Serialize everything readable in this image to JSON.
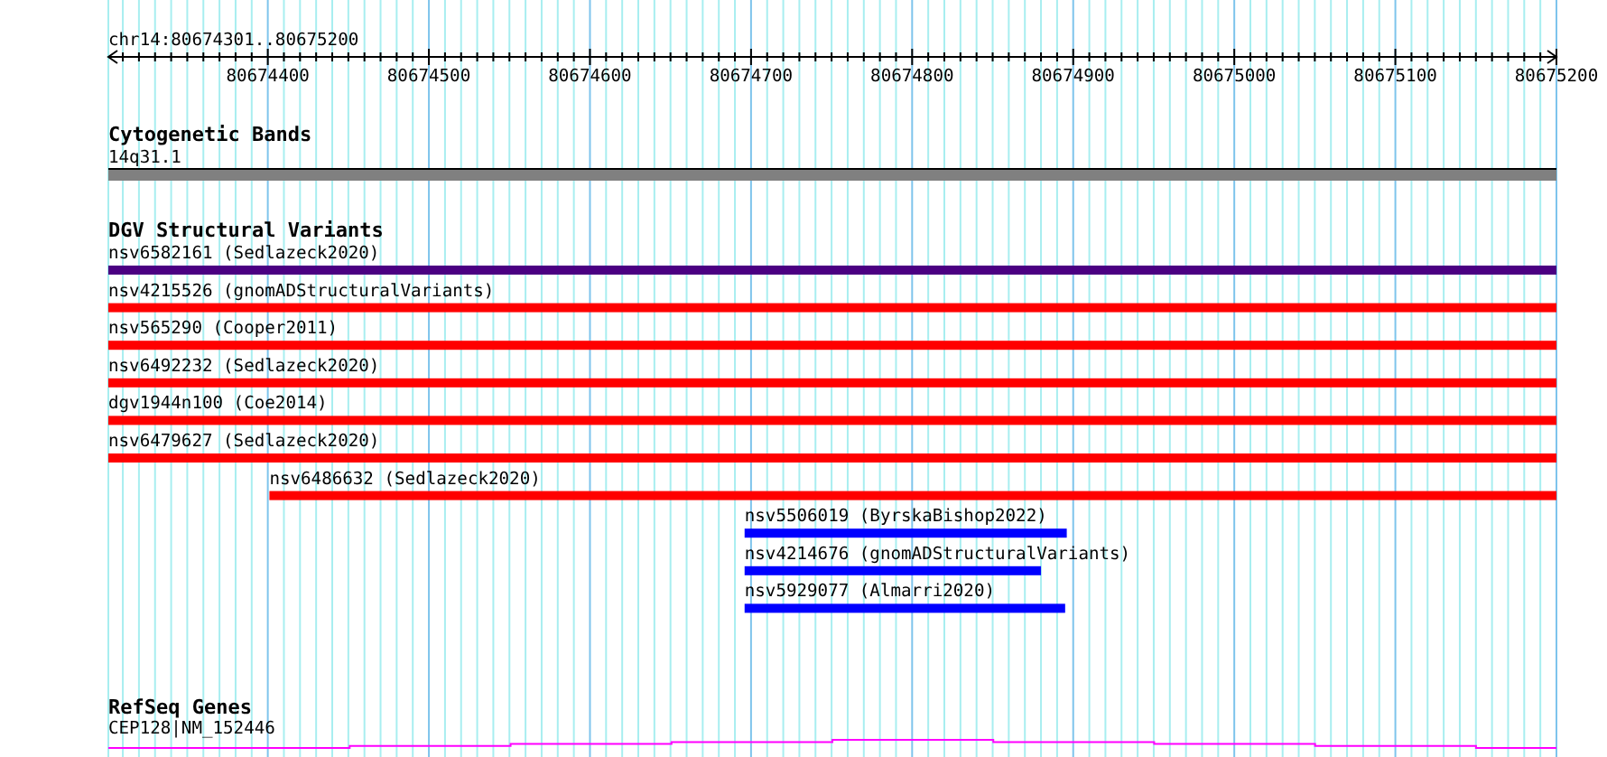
{
  "ruler": {
    "range_label": "chr14:80674301..80675200",
    "tick_labels": [
      "80674400",
      "80674500",
      "80674600",
      "80674700",
      "80674800",
      "80674900",
      "80675000",
      "80675100",
      "80675200"
    ]
  },
  "tracks": [
    {
      "kind": "band",
      "title": "Cytogenetic Bands",
      "features": [
        {
          "label": "14q31.1",
          "color": "#808080"
        }
      ]
    },
    {
      "kind": "variants",
      "title": "DGV Structural Variants",
      "features": [
        {
          "label": "nsv6582161 (Sedlazeck2020)",
          "color": "#4b0082"
        },
        {
          "label": "nsv4215526 (gnomADStructuralVariants)",
          "color": "#ff0000"
        },
        {
          "label": "nsv565290 (Cooper2011)",
          "color": "#ff0000"
        },
        {
          "label": "nsv6492232 (Sedlazeck2020)",
          "color": "#ff0000"
        },
        {
          "label": "dgv1944n100 (Coe2014)",
          "color": "#ff0000"
        },
        {
          "label": "nsv6479627 (Sedlazeck2020)",
          "color": "#ff0000"
        },
        {
          "label": "nsv6486632 (Sedlazeck2020)",
          "color": "#ff0000"
        },
        {
          "label": "nsv5506019 (ByrskaBishop2022)",
          "color": "#0000ff"
        },
        {
          "label": "nsv4214676 (gnomADStructuralVariants)",
          "color": "#0000ff"
        },
        {
          "label": "nsv5929077 (Almarri2020)",
          "color": "#0000ff"
        }
      ]
    },
    {
      "kind": "gene",
      "title": "RefSeq Genes",
      "features": [
        {
          "label": "CEP128|NM_152446",
          "color": "#ff00ff"
        }
      ]
    }
  ]
}
